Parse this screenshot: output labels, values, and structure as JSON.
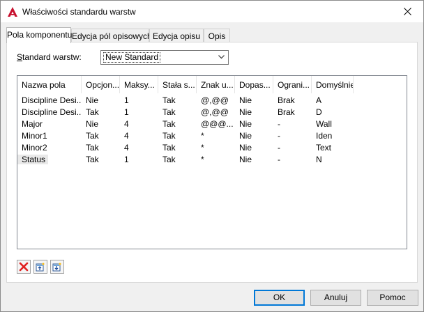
{
  "window": {
    "title": "Właściwości standardu warstw"
  },
  "tabs": [
    {
      "label": "Pola komponentu",
      "active": true
    },
    {
      "label": "Edycja pól opisowych",
      "active": false
    },
    {
      "label": "Edycja opisu",
      "active": false
    },
    {
      "label": "Opis",
      "active": false
    }
  ],
  "standard": {
    "label_prefix": "S",
    "label_rest": "tandard warstw:",
    "value": "New Standard"
  },
  "table": {
    "columns": [
      "Nazwa pola",
      "Opcjon...",
      "Maksy...",
      "Stała s...",
      "Znak u...",
      "Dopas...",
      "Ograni...",
      "Domyślnie"
    ],
    "rows": [
      [
        "Discipline Desi...",
        "Nie",
        "1",
        "Tak",
        "@,@@",
        "Nie",
        "Brak",
        "A"
      ],
      [
        "Discipline Desi...",
        "Tak",
        "1",
        "Tak",
        "@,@@",
        "Nie",
        "Brak",
        "D"
      ],
      [
        "Major",
        "Nie",
        "4",
        "Tak",
        "@@@...",
        "Nie",
        "-",
        "Wall"
      ],
      [
        "Minor1",
        "Tak",
        "4",
        "Tak",
        "*",
        "Nie",
        "-",
        "Iden"
      ],
      [
        "Minor2",
        "Tak",
        "4",
        "Tak",
        "*",
        "Nie",
        "-",
        "Text"
      ],
      [
        "Status",
        "Tak",
        "1",
        "Tak",
        "*",
        "Nie",
        "-",
        "N"
      ]
    ],
    "selected_row": 5
  },
  "toolbar": {
    "icons": [
      "delete-icon",
      "move-up-icon",
      "move-down-icon"
    ]
  },
  "buttons": {
    "ok": "OK",
    "cancel": "Anuluj",
    "help": "Pomoc"
  },
  "colors": {
    "accent": "#0078d7",
    "delete_red": "#e02020",
    "app_red": "#c8102e"
  }
}
